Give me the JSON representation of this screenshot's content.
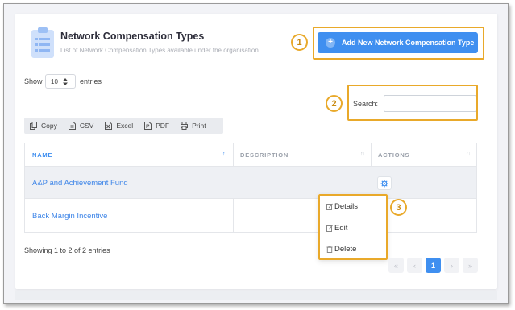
{
  "header": {
    "title": "Network Compensation Types",
    "subtitle": "List of Network Compensation Types available under the organisation",
    "add_button_label": "Add New Network Compensation Type"
  },
  "markers": {
    "m1": "1",
    "m2": "2",
    "m3": "3"
  },
  "length_control": {
    "show_label": "Show",
    "value": "10",
    "entries_label": "entries"
  },
  "search": {
    "label": "Search:",
    "value": ""
  },
  "toolbar": {
    "copy": "Copy",
    "csv": "CSV",
    "excel": "Excel",
    "pdf": "PDF",
    "print": "Print"
  },
  "table": {
    "columns": [
      "NAME",
      "DESCRIPTION",
      "ACTIONS"
    ],
    "rows": [
      {
        "name": "A&P and Achievement Fund",
        "description": ""
      },
      {
        "name": "Back Margin Incentive",
        "description": ""
      }
    ]
  },
  "actions_menu": {
    "items": [
      "Details",
      "Edit",
      "Delete"
    ]
  },
  "footer": {
    "info": "Showing 1 to 2 of 2 entries"
  },
  "pagination": {
    "first": "«",
    "prev": "‹",
    "current": "1",
    "next": "›",
    "last": "»"
  },
  "colors": {
    "accent": "#3f8ff0",
    "highlight": "#e9a92a",
    "link": "#3f86e8"
  },
  "icons": [
    "clipboard-icon",
    "plus-circle-icon",
    "copy-icon",
    "csv-icon",
    "excel-icon",
    "pdf-icon",
    "print-icon",
    "sort-icon",
    "gear-icon",
    "edit-icon",
    "trash-icon"
  ]
}
